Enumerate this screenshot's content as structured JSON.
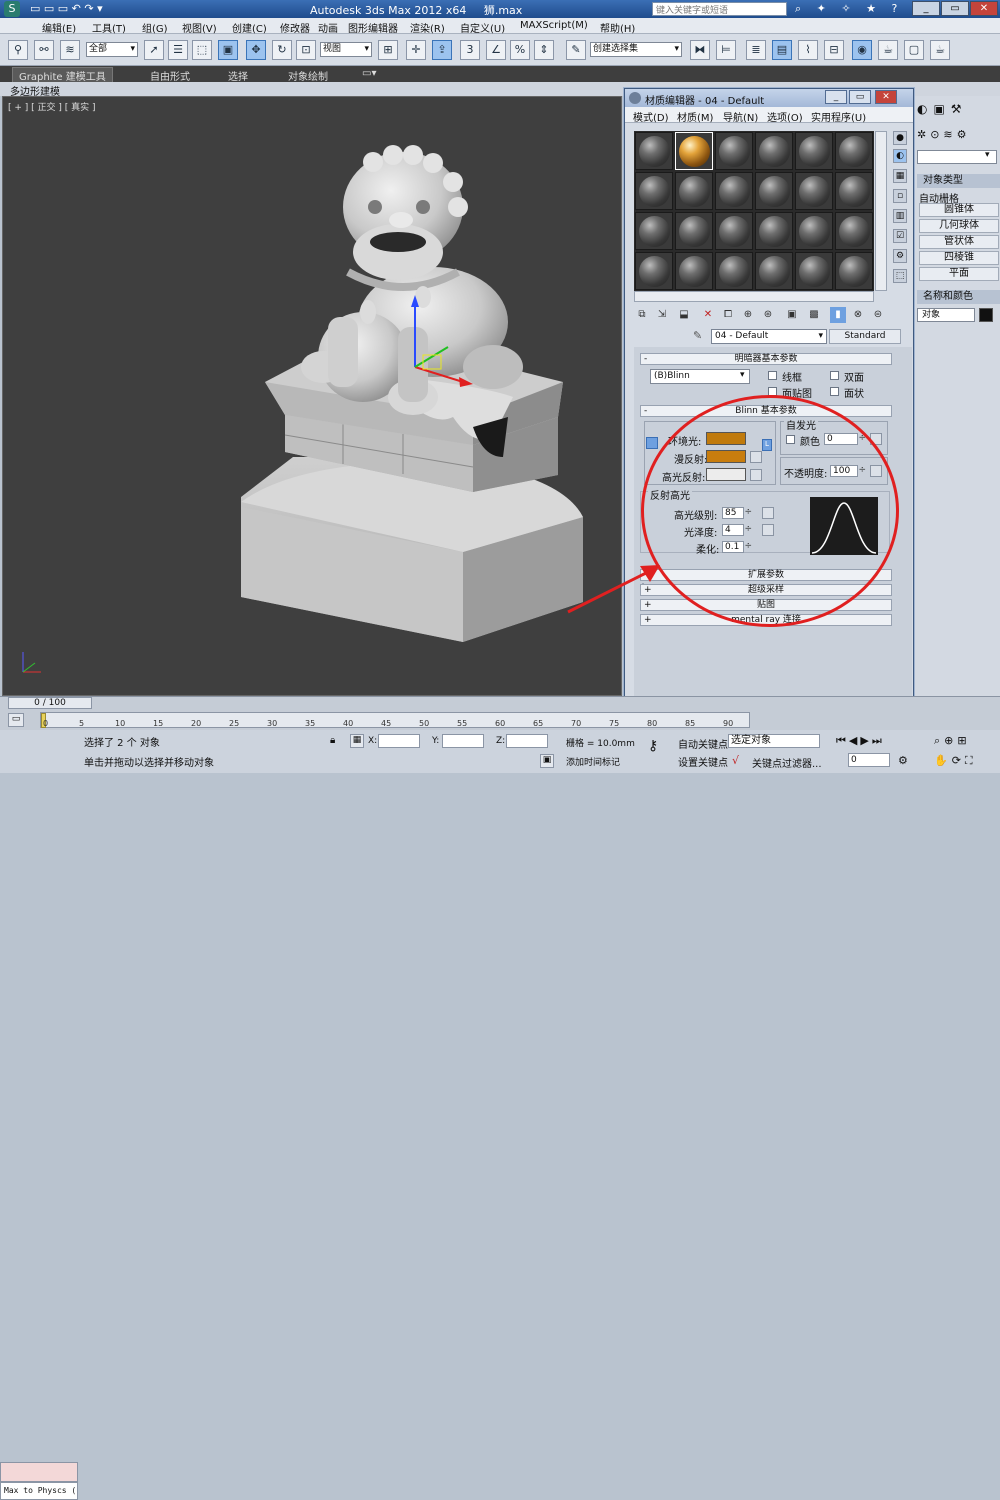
{
  "app": {
    "title": "Autodesk 3ds Max  2012 x64",
    "file": "狮.max",
    "search_placeholder": "键入关键字或短语"
  },
  "menu": [
    "编辑(E)",
    "工具(T)",
    "组(G)",
    "视图(V)",
    "创建(C)",
    "修改器",
    "动画",
    "图形编辑器",
    "渲染(R)",
    "自定义(U)",
    "MAXScript(M)",
    "帮助(H)"
  ],
  "toolbar": {
    "selection_filter": "全部",
    "ref_coord": "视图",
    "named_selection": "创建选择集"
  },
  "ribbon": {
    "tabs": [
      "Graphite 建模工具",
      "自由形式",
      "选择",
      "对象绘制"
    ],
    "active_tab": "Graphite 建模工具",
    "subtab": "多边形建模"
  },
  "viewport": {
    "label": "[ + ] [ 正交 ] [ 真实 ]"
  },
  "command_panel": {
    "dropdown": "",
    "rollout_object_type": "对象类型",
    "autogrid": "自动栅格",
    "buttons": [
      "圆锥体",
      "几何球体",
      "管状体",
      "四棱锥",
      "平面"
    ],
    "rollout_name_color": "名称和颜色",
    "name_value": "对象"
  },
  "material_editor": {
    "title": "材质编辑器 - 04 - Default",
    "menu": [
      "模式(D)",
      "材质(M)",
      "导航(N)",
      "选项(O)",
      "实用程序(U)"
    ],
    "material_name": "04 - Default",
    "material_type": "Standard",
    "shader_rollout": "明暗器基本参数",
    "shader": "(B)Blinn",
    "shader_options": [
      "线框",
      "双面",
      "面贴图",
      "面状"
    ],
    "blinn_rollout": "Blinn 基本参数",
    "self_illum_label": "自发光",
    "color_label": "颜色",
    "self_illum_value": "0",
    "ambient_label": "环境光:",
    "diffuse_label": "漫反射:",
    "specular_label": "高光反射:",
    "opacity_label": "不透明度:",
    "opacity_value": "100",
    "highlights_label": "反射高光",
    "spec_level_label": "高光级别:",
    "spec_level_value": "85",
    "glossiness_label": "光泽度:",
    "glossiness_value": "4",
    "soften_label": "柔化:",
    "soften_value": "0.1",
    "rollouts": [
      "扩展参数",
      "超级采样",
      "贴图",
      "mental ray 连接"
    ],
    "colors": {
      "ambient": "#c07a0c",
      "diffuse": "#c87d0e",
      "specular": "#ececec"
    }
  },
  "timeline": {
    "frame": "0 / 100",
    "ticks": [
      "0",
      "5",
      "10",
      "15",
      "20",
      "25",
      "30",
      "35",
      "40",
      "45",
      "50",
      "55",
      "60",
      "65",
      "70",
      "75",
      "80",
      "85",
      "90"
    ]
  },
  "status": {
    "maxscript": "Max to Physcs (",
    "selected": "选择了 2 个 对象",
    "prompt": "单击并拖动以选择并移动对象",
    "x_label": "X:",
    "y_label": "Y:",
    "z_label": "Z:",
    "grid": "栅格 = 10.0mm",
    "add_time_tag": "添加时间标记",
    "auto_key": "自动关键点",
    "set_key": "设置关键点",
    "selected_objects": "选定对象",
    "key_filters": "关键点过滤器...",
    "frame_value": "0"
  }
}
